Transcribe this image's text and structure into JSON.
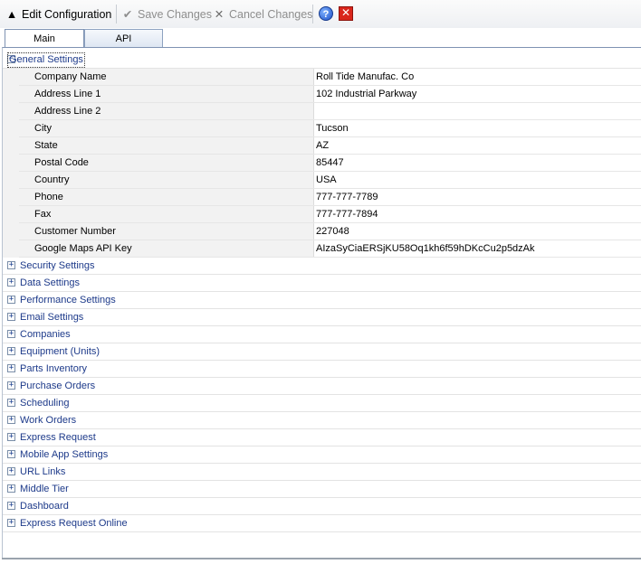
{
  "toolbar": {
    "edit_label": "Edit Configuration",
    "save_label": "Save Changes",
    "cancel_label": "Cancel Changes",
    "help_symbol": "?",
    "close_symbol": "✕"
  },
  "tabs": [
    {
      "label": "Main",
      "active": true
    },
    {
      "label": "API",
      "active": false
    }
  ],
  "general_settings": {
    "label": "General Settings",
    "properties": [
      {
        "name": "Company Name",
        "value": "Roll Tide Manufac. Co"
      },
      {
        "name": "Address Line 1",
        "value": "102 Industrial Parkway"
      },
      {
        "name": "Address Line 2",
        "value": ""
      },
      {
        "name": "City",
        "value": "Tucson"
      },
      {
        "name": "State",
        "value": "AZ"
      },
      {
        "name": "Postal Code",
        "value": "85447"
      },
      {
        "name": "Country",
        "value": "USA"
      },
      {
        "name": "Phone",
        "value": "777-777-7789"
      },
      {
        "name": "Fax",
        "value": "777-777-7894"
      },
      {
        "name": "Customer Number",
        "value": "227048"
      },
      {
        "name": "Google Maps API Key",
        "value": "AIzaSyCiaERSjKU58Oq1kh6f59hDKcCu2p5dzAk"
      }
    ]
  },
  "categories": [
    "Security Settings",
    "Data Settings",
    "Performance Settings",
    "Email Settings",
    "Companies",
    "Equipment (Units)",
    "Parts Inventory",
    "Purchase Orders",
    "Scheduling",
    "Work Orders",
    "Express Request",
    "Mobile App Settings",
    "URL Links",
    "Middle Tier",
    "Dashboard",
    "Express Request Online"
  ]
}
